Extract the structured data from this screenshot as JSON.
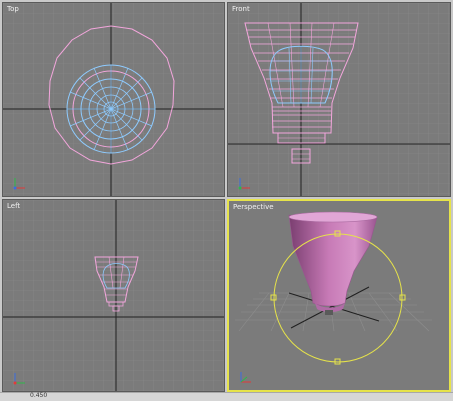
{
  "viewports": {
    "top": {
      "label": "Top"
    },
    "front": {
      "label": "Front"
    },
    "left": {
      "label": "Left"
    },
    "perspective": {
      "label": "Perspective"
    }
  },
  "status": {
    "text": "0.450"
  },
  "colors": {
    "viewport_bg": "#7b7b7b",
    "grid": "#8c8c8c",
    "axis": "#202020",
    "wire_pink": "#f3a6dc",
    "wire_blue": "#8ecbff",
    "active_border": "#e6e34a",
    "mesh_fill": "#c77ab6"
  }
}
